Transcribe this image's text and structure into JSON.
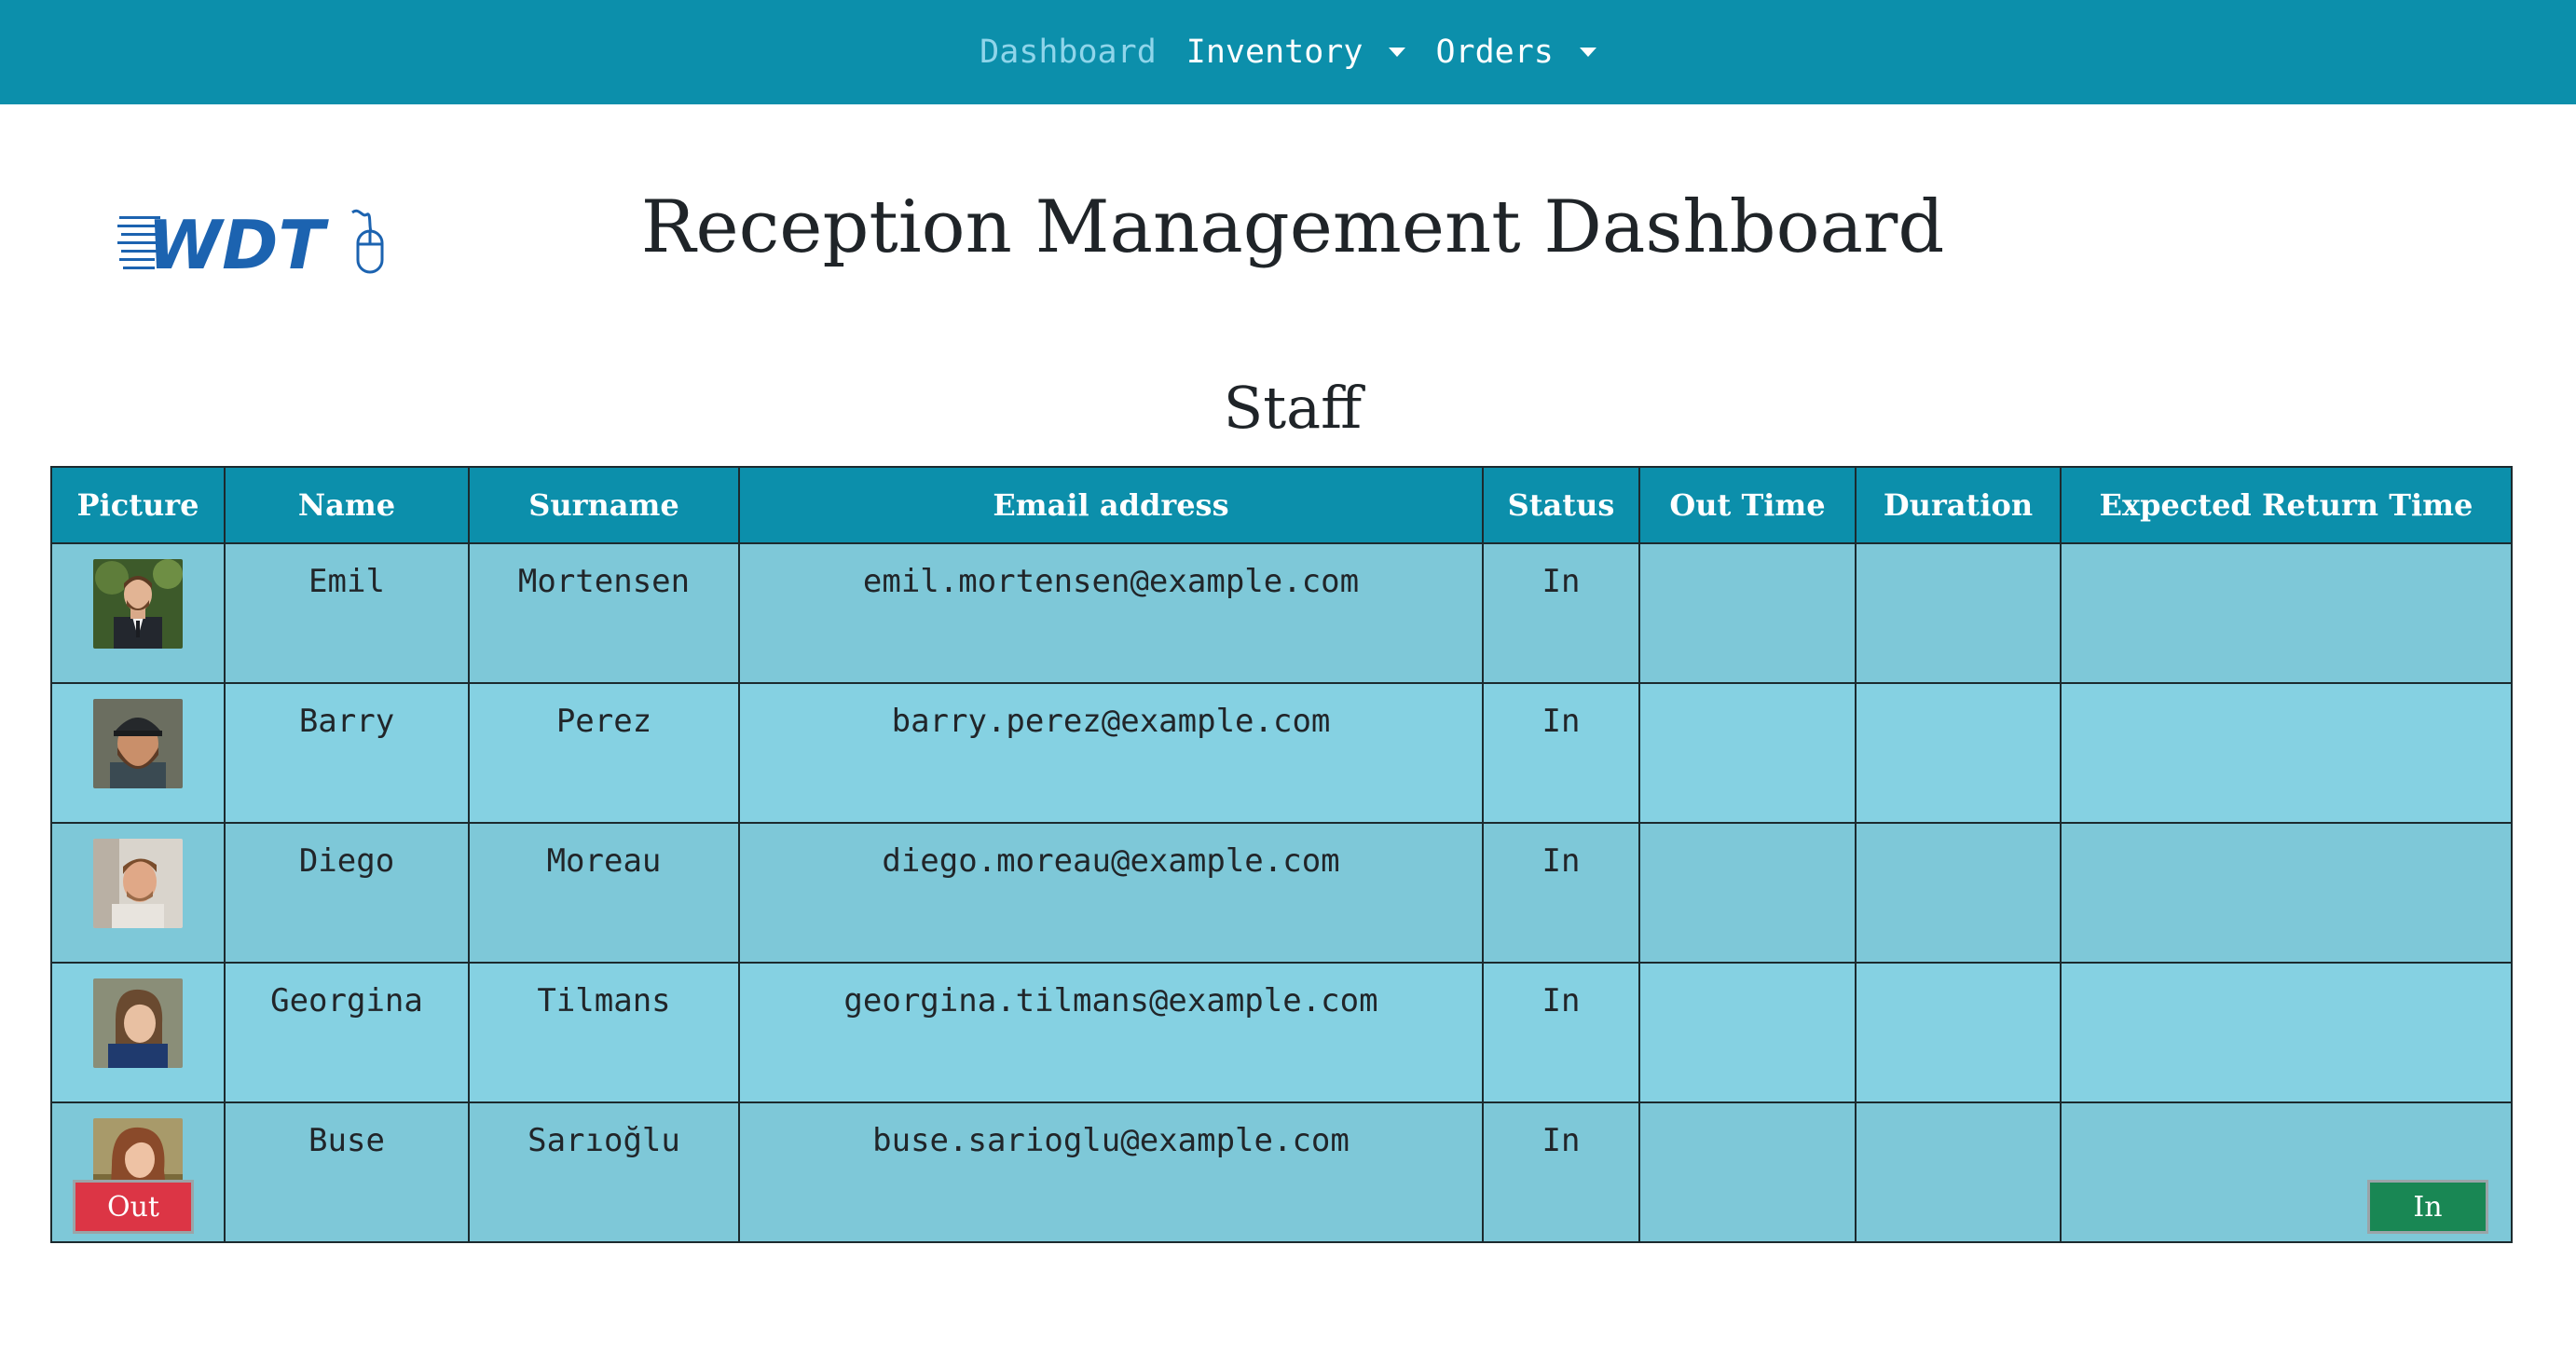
{
  "nav": {
    "dashboard": "Dashboard",
    "inventory": "Inventory",
    "orders": "Orders"
  },
  "logo_text": "WDT",
  "page_title": "Reception Management Dashboard",
  "section_title": "Staff",
  "table": {
    "headers": [
      "Picture",
      "Name",
      "Surname",
      "Email address",
      "Status",
      "Out Time",
      "Duration",
      "Expected Return Time"
    ],
    "rows": [
      {
        "name": "Emil",
        "surname": "Mortensen",
        "email": "emil.mortensen@example.com",
        "status": "In",
        "out_time": "",
        "duration": "",
        "expected_return": ""
      },
      {
        "name": "Barry",
        "surname": "Perez",
        "email": "barry.perez@example.com",
        "status": "In",
        "out_time": "",
        "duration": "",
        "expected_return": ""
      },
      {
        "name": "Diego",
        "surname": "Moreau",
        "email": "diego.moreau@example.com",
        "status": "In",
        "out_time": "",
        "duration": "",
        "expected_return": ""
      },
      {
        "name": "Georgina",
        "surname": "Tilmans",
        "email": "georgina.tilmans@example.com",
        "status": "In",
        "out_time": "",
        "duration": "",
        "expected_return": ""
      },
      {
        "name": "Buse",
        "surname": "Sarıoğlu",
        "email": "buse.sarioglu@example.com",
        "status": "In",
        "out_time": "",
        "duration": "",
        "expected_return": ""
      }
    ]
  },
  "buttons": {
    "out": "Out",
    "in": "In"
  },
  "colors": {
    "navbar": "#0c8fab",
    "active_nav": "#8fd5ea",
    "row_odd": "#7ec8d8",
    "row_even": "#85d1e2",
    "out_button": "#dc3545",
    "in_button": "#198754",
    "logo_blue": "#1c63b0"
  }
}
